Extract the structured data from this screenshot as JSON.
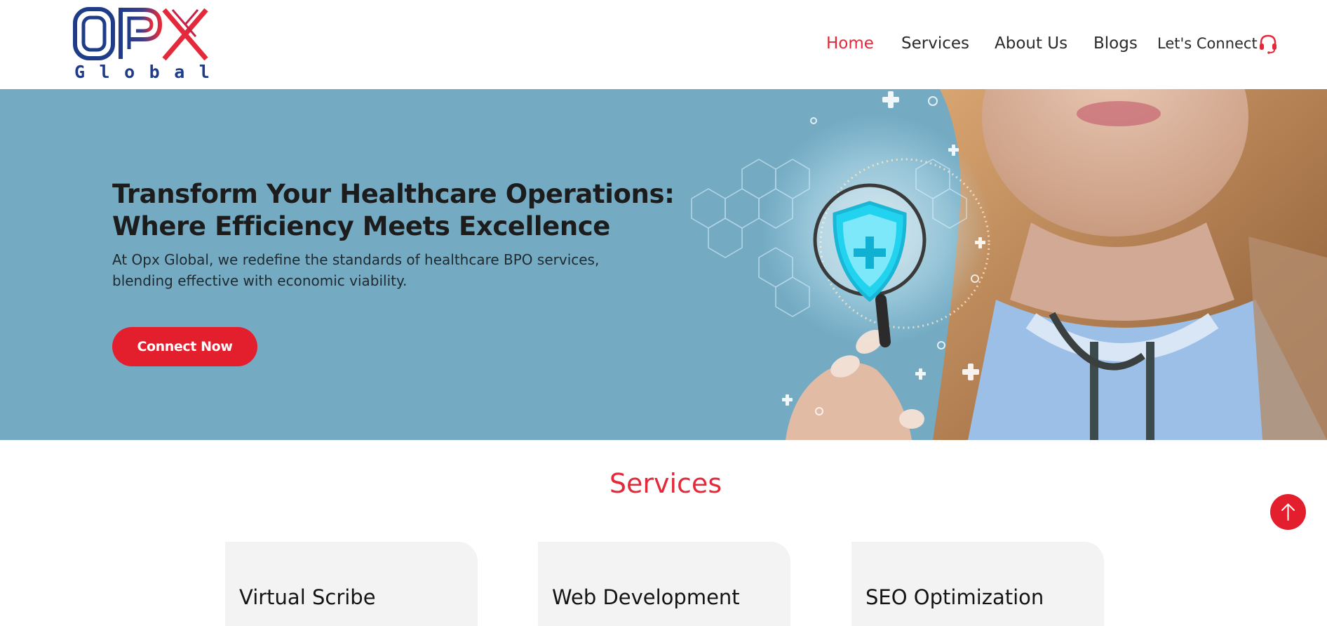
{
  "brand": {
    "logo_mark": "OPX",
    "logo_sub": "Global",
    "colors": {
      "navy": "#1f3c88",
      "red": "#e3293a"
    }
  },
  "nav": {
    "items": [
      {
        "label": "Home",
        "active": true
      },
      {
        "label": "Services",
        "active": false
      },
      {
        "label": "About Us",
        "active": false
      },
      {
        "label": "Blogs",
        "active": false
      }
    ],
    "cta_label": "Let's Connect",
    "cta_icon": "headset-icon"
  },
  "hero": {
    "title_line1": "Transform Your Healthcare Operations:",
    "title_line2": "Where Efficiency Meets Excellence",
    "subtitle_line1": "At Opx Global, we redefine the standards of healthcare BPO services,",
    "subtitle_line2": "blending effective with economic viability.",
    "button_label": "Connect Now",
    "background_color": "#74abc3",
    "image": "doctor-holding-digital-shield-magnifier"
  },
  "services": {
    "heading": "Services",
    "cards": [
      {
        "title": "Virtual Scribe"
      },
      {
        "title": "Web Development"
      },
      {
        "title": "SEO Optimization"
      }
    ]
  },
  "scroll_top": {
    "icon": "arrow-up-icon",
    "color": "#e31e2d"
  }
}
